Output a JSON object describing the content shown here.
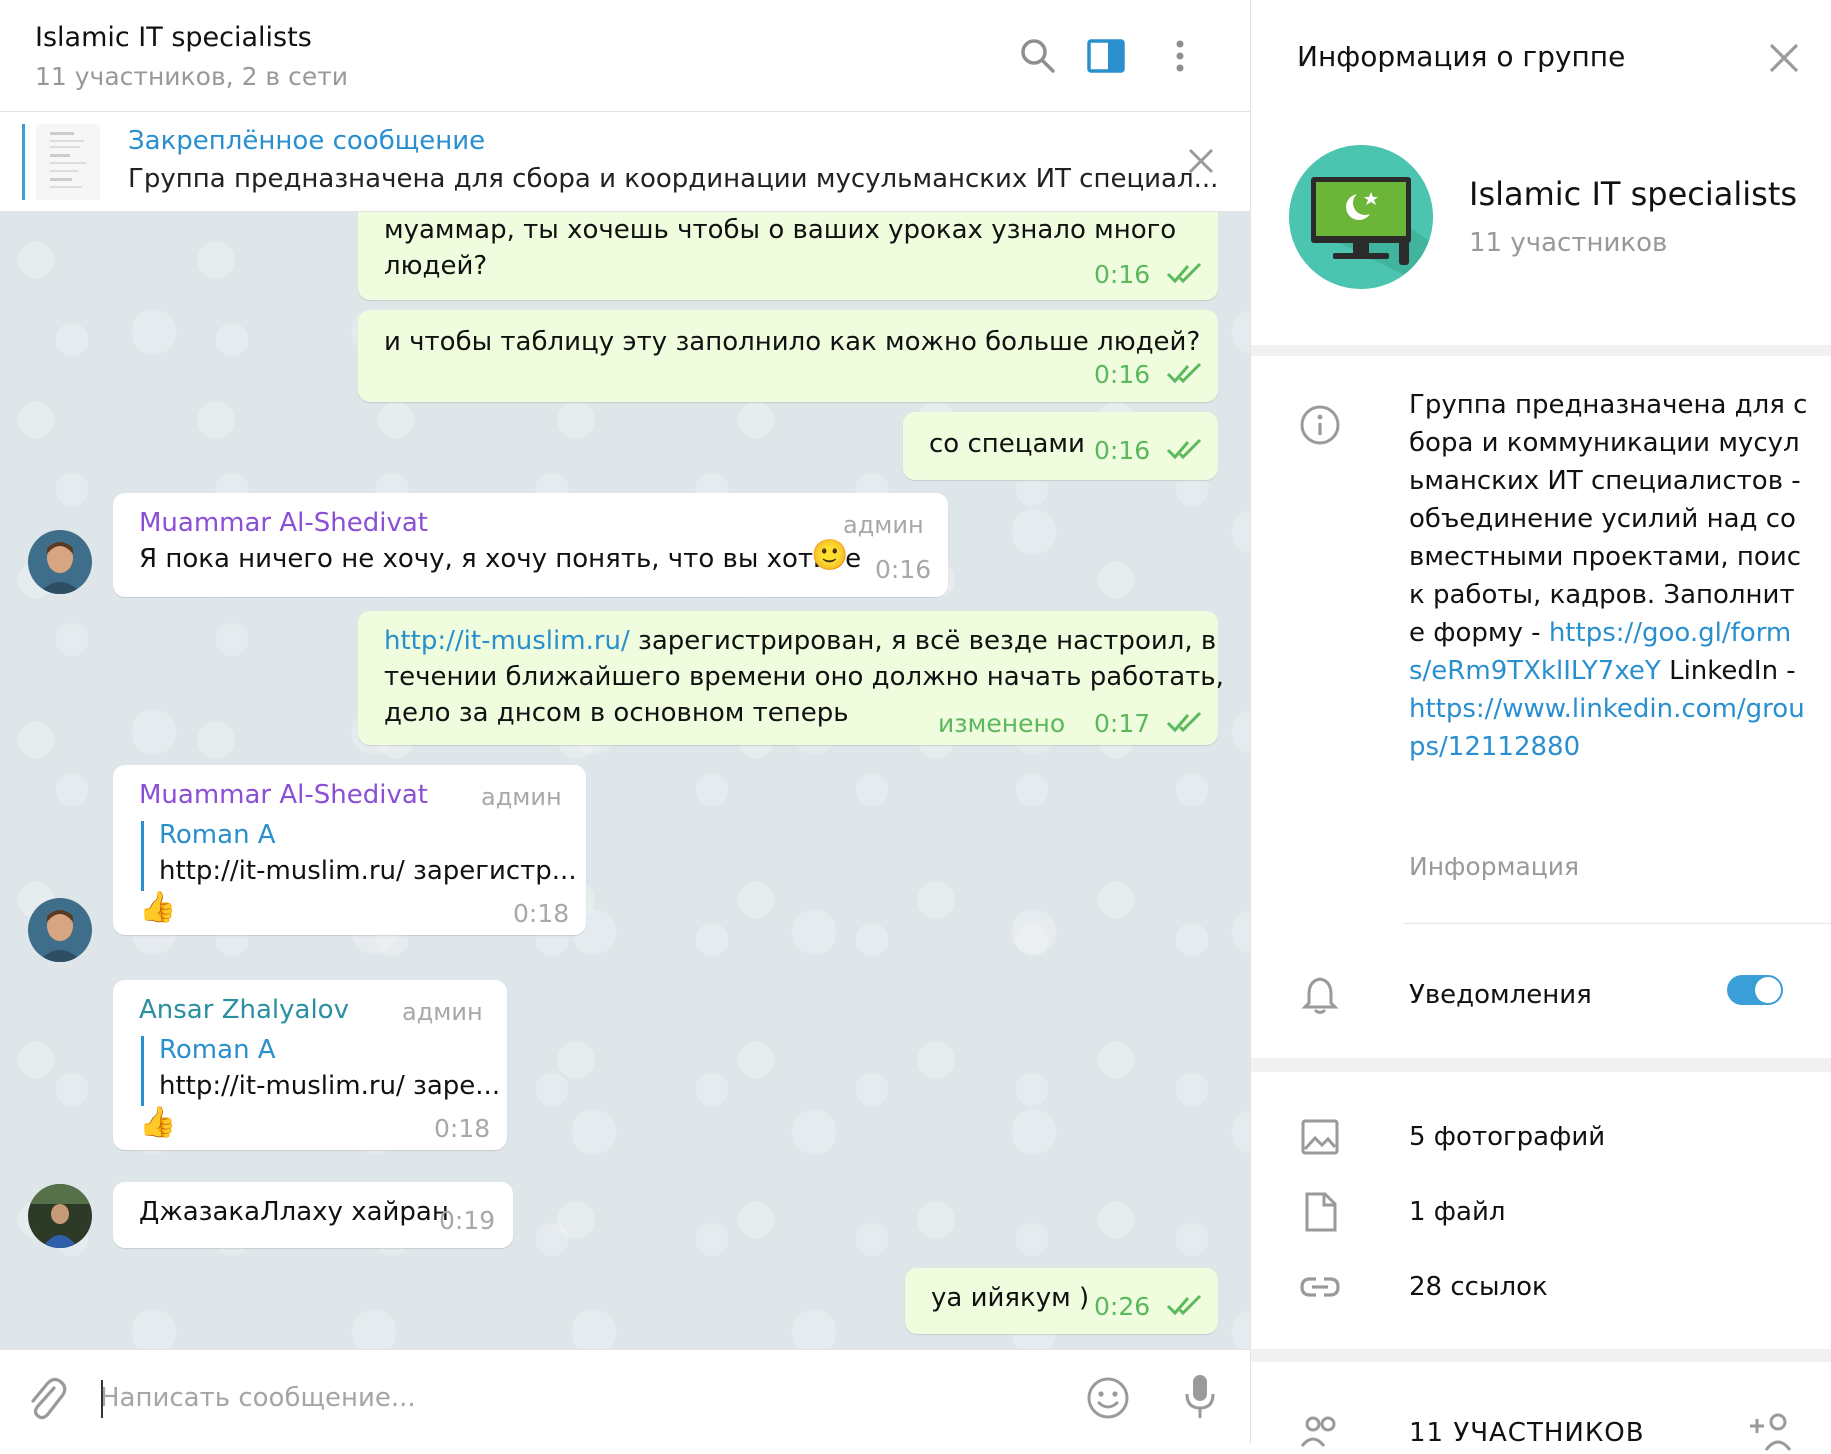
{
  "header": {
    "title": "Islamic IT specialists",
    "subtitle": "11 участников, 2 в сети"
  },
  "pinned": {
    "title": "Закреплённое сообщение",
    "text": "Группа предназначена для сбора и координации мусульманских ИТ специал..."
  },
  "messages": [
    {
      "dir": "out",
      "text_line1": "муаммар, ты хочешь чтобы о ваших уроках узнало много",
      "text_line2": "людей?",
      "time": "0:16"
    },
    {
      "dir": "out",
      "text": "и чтобы таблицу эту заполнило как можно больше людей?",
      "time": "0:16"
    },
    {
      "dir": "out",
      "text": "со спецами",
      "time": "0:16"
    },
    {
      "dir": "in",
      "sender": "Muammar Al-Shedivat",
      "role": "админ",
      "text": "Я пока ничего не хочу, я хочу понять, что вы хотите",
      "emoji": "🙂",
      "time": "0:16"
    },
    {
      "dir": "out",
      "link": "http://it-muslim.ru/",
      "text_line1": " зарегистрирован, я всё везде настроил, в",
      "text_line2": "течении ближайшего времени оно должно начать работать,",
      "text_line3": "дело за днсом в основном теперь",
      "edited": "изменено",
      "time": "0:17"
    },
    {
      "dir": "in",
      "sender": "Muammar Al-Shedivat",
      "role": "админ",
      "quote_name": "Roman A",
      "quote_text": "http://it-muslim.ru/ зарегистр...",
      "emoji": "👍",
      "time": "0:18"
    },
    {
      "dir": "in",
      "sender": "Ansar Zhalyalov",
      "role": "админ",
      "quote_name": "Roman A",
      "quote_text": "http://it-muslim.ru/ заре...",
      "emoji": "👍",
      "time": "0:18"
    },
    {
      "dir": "in",
      "text": "ДжазакаЛлаху хайран",
      "time": "0:19"
    },
    {
      "dir": "out",
      "text": "уа ийякум )",
      "time": "0:26"
    }
  ],
  "composer": {
    "placeholder": "Написать сообщение..."
  },
  "info_panel": {
    "title": "Информация о группе",
    "group_name": "Islamic IT specialists",
    "members": "11 участников",
    "description_text": "Группа предназначена для сбора и коммуникации мусульманских ИТ специалистов - объединение усилий над совместными проектами, поиск работы, кадров. Заполните форму - ",
    "description_link1": "https://goo.gl/forms/eRm9TXklILY7xeY",
    "description_mid": " LinkedIn - ",
    "description_link2": "https://www.linkedin.com/groups/12112880",
    "description_label": "Информация",
    "notifications_label": "Уведомления",
    "notifications_on": true,
    "media": [
      {
        "icon": "image-icon",
        "label": "5 фотографий"
      },
      {
        "icon": "file-icon",
        "label": "1 файл"
      },
      {
        "icon": "link-icon",
        "label": "28 ссылок"
      }
    ],
    "members_header": "11 УЧАСТНИКОВ"
  },
  "colors": {
    "accent": "#2a8fcf",
    "outgoing_bubble": "#effdde",
    "chat_background": "#dfe6ea",
    "sender_purple": "#8a4fd6",
    "sender_teal": "#2a8fa0",
    "time_green": "#5cb85c"
  }
}
